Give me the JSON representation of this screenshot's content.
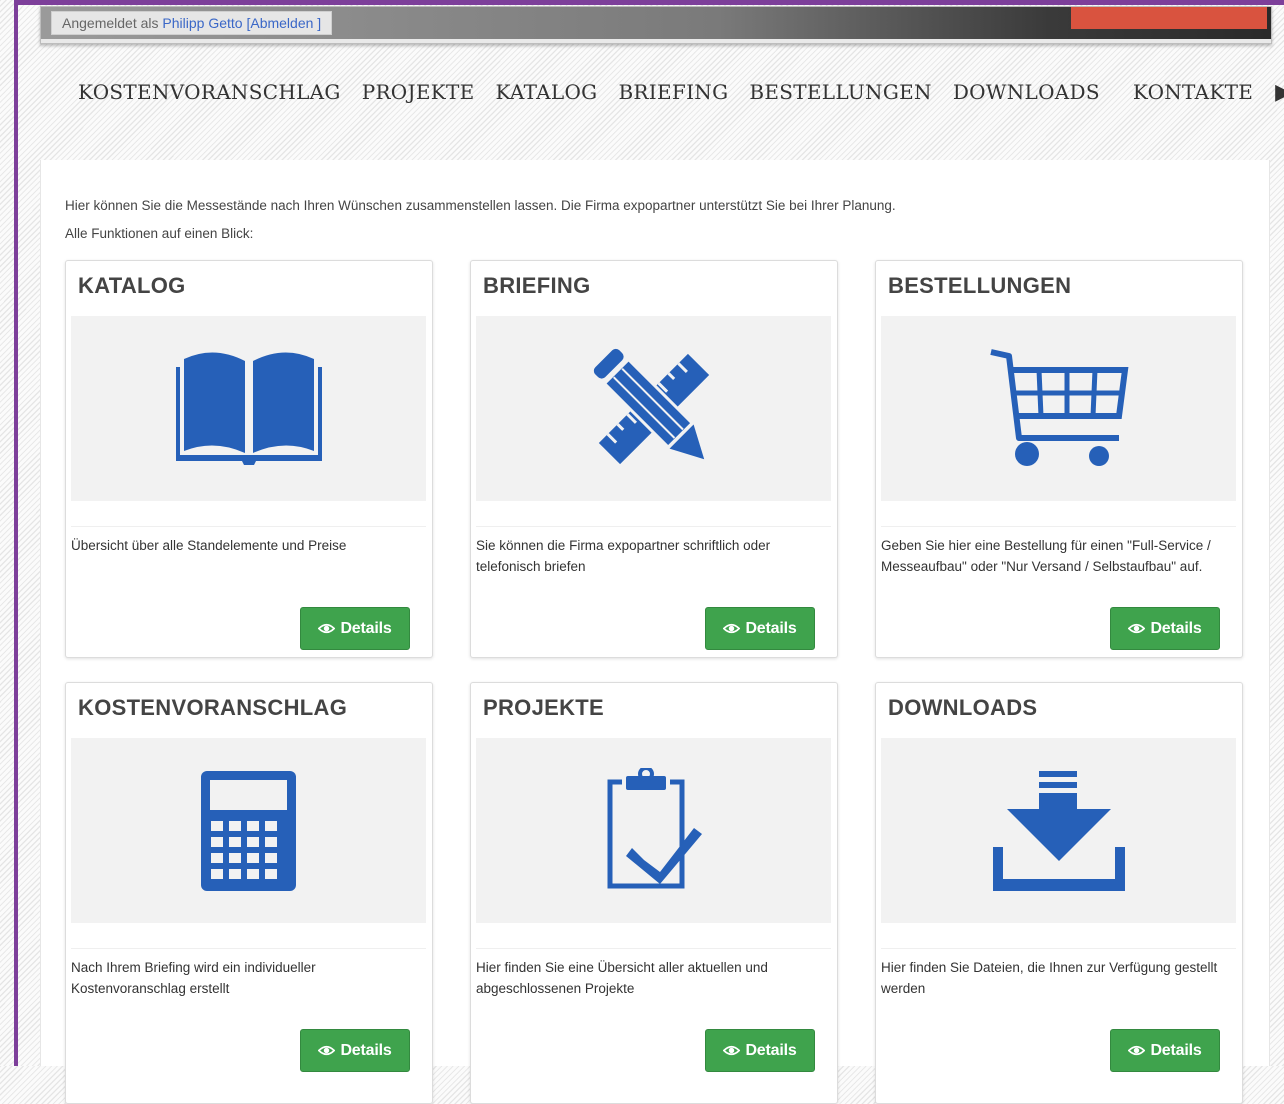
{
  "topbar": {
    "logged_in_prefix": "Angemeldet als",
    "user_name": "Philipp Getto",
    "logout_open": "[",
    "logout_label": "Abmelden",
    "logout_close": "]"
  },
  "nav": {
    "items": [
      "KOSTENVORANSCHLAG",
      "PROJEKTE",
      "KATALOG",
      "BRIEFING",
      "BESTELLUNGEN",
      "DOWNLOADS",
      "KONTAKTE"
    ],
    "more_icon": "play-arrow-icon"
  },
  "intro": {
    "line1": "Hier können Sie die Messestände nach Ihren Wünschen zusammenstellen lassen. Die Firma expopartner unterstützt Sie bei Ihrer Planung.",
    "line2": "Alle Funktionen auf einen Blick:"
  },
  "cards": [
    {
      "title": "KATALOG",
      "icon": "open-book-icon",
      "text": "Übersicht über alle Standelemente und Preise",
      "button": "Details"
    },
    {
      "title": "BRIEFING",
      "icon": "pencil-ruler-icon",
      "text": "Sie können die Firma expopartner schriftlich oder telefonisch briefen",
      "button": "Details"
    },
    {
      "title": "BESTELLUNGEN",
      "icon": "shopping-cart-icon",
      "text": "Geben Sie hier eine Bestellung für einen \"Full-Service / Messeaufbau\" oder \"Nur Versand / Selbstaufbau\" auf.",
      "button": "Details"
    },
    {
      "title": "KOSTENVORANSCHLAG",
      "icon": "calculator-icon",
      "text": "Nach Ihrem Briefing wird ein individueller Kostenvoranschlag erstellt",
      "button": "Details"
    },
    {
      "title": "PROJEKTE",
      "icon": "clipboard-check-icon",
      "text": "Hier finden Sie eine Übersicht aller aktuellen und abgeschlossenen Projekte",
      "button": "Details"
    },
    {
      "title": "DOWNLOADS",
      "icon": "download-tray-icon",
      "text": "Hier finden Sie Dateien, die Ihnen zur Verfügung gestellt werden",
      "button": "Details"
    }
  ],
  "colors": {
    "accent_blue": "#2660b8",
    "button_green": "#3fa34d",
    "frame_purple": "#7d3f9a",
    "link_blue": "#3a67c7"
  }
}
